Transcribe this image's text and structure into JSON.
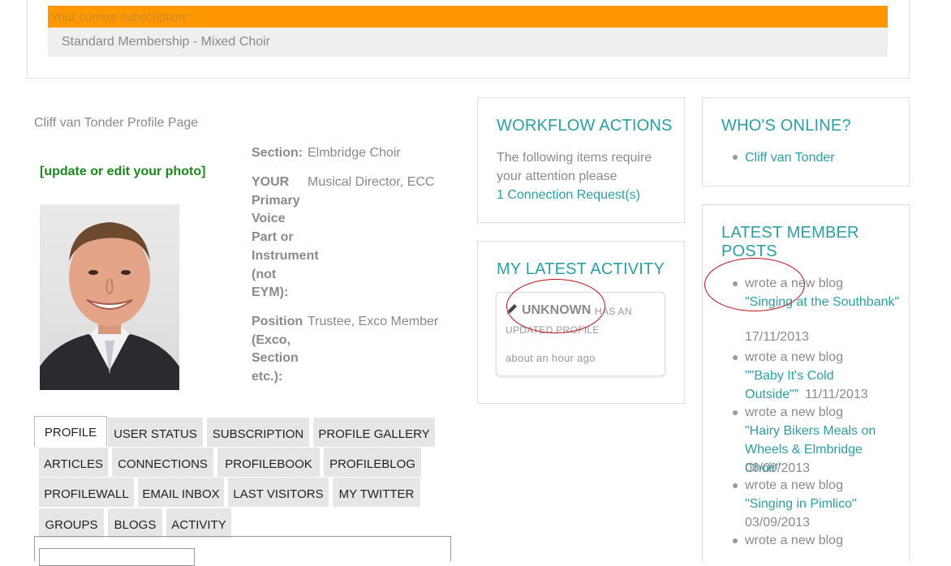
{
  "subscription": {
    "header": "Your current subscription:",
    "plan": "Standard Membership - Mixed Choir"
  },
  "profile": {
    "title": "Cliff van Tonder Profile Page",
    "photo_link": "[update or edit your photo]",
    "fields": [
      {
        "label_lines": [
          "Section:"
        ],
        "value": "Elmbridge Choir"
      },
      {
        "label_lines": [
          "YOUR",
          "Primary",
          "Voice",
          "Part or",
          "Instrument",
          "(not",
          "EYM):"
        ],
        "value": "Musical Director, ECC"
      },
      {
        "label_lines": [
          "Position",
          "(Exco,",
          "Section",
          "etc.):"
        ],
        "value": "Trustee, Exco Member"
      }
    ]
  },
  "tabs": [
    "PROFILE",
    "USER STATUS",
    "SUBSCRIPTION",
    "PROFILE GALLERY",
    "ARTICLES",
    "CONNECTIONS",
    "PROFILEBOOK",
    "PROFILEBLOG",
    "PROFILEWALL",
    "EMAIL INBOX",
    "LAST VISITORS",
    "MY TWITTER",
    "GROUPS",
    "BLOGS",
    "ACTIVITY"
  ],
  "workflow": {
    "title": "WORKFLOW ACTIONS",
    "text": "The following items require your attention please",
    "link": "1 Connection Request(s)"
  },
  "activity": {
    "title": "MY LATEST ACTIVITY",
    "name": "UNKNOWN",
    "action_1": "HAS AN",
    "action_2": "UPDATED PROFILE",
    "time": "about an hour ago"
  },
  "online": {
    "title": "WHO'S ONLINE?",
    "users": [
      "Cliff van Tonder"
    ]
  },
  "latest_posts": {
    "title_1": "LATEST MEMBER",
    "title_2": "POSTS",
    "prefix": "wrote a new blog",
    "posts": [
      {
        "title": "\"Singing at the Southbank\"",
        "date": "17/11/2013"
      },
      {
        "title": "\"\"Baby It's Cold Outside\"\"",
        "date": "11/11/2013"
      },
      {
        "title": "\"Hairy Bikers Meals on Wheels & Elmbridge Choir\"",
        "date": "06/09/2013"
      },
      {
        "title": "\"Singing in Pimlico\"",
        "date": "03/09/2013"
      }
    ]
  },
  "colors": {
    "accent": "#2a9fa7",
    "subscription_bar": "#ff9800",
    "photo_link": "#1a8a1a",
    "annotation": "#c0101a"
  }
}
